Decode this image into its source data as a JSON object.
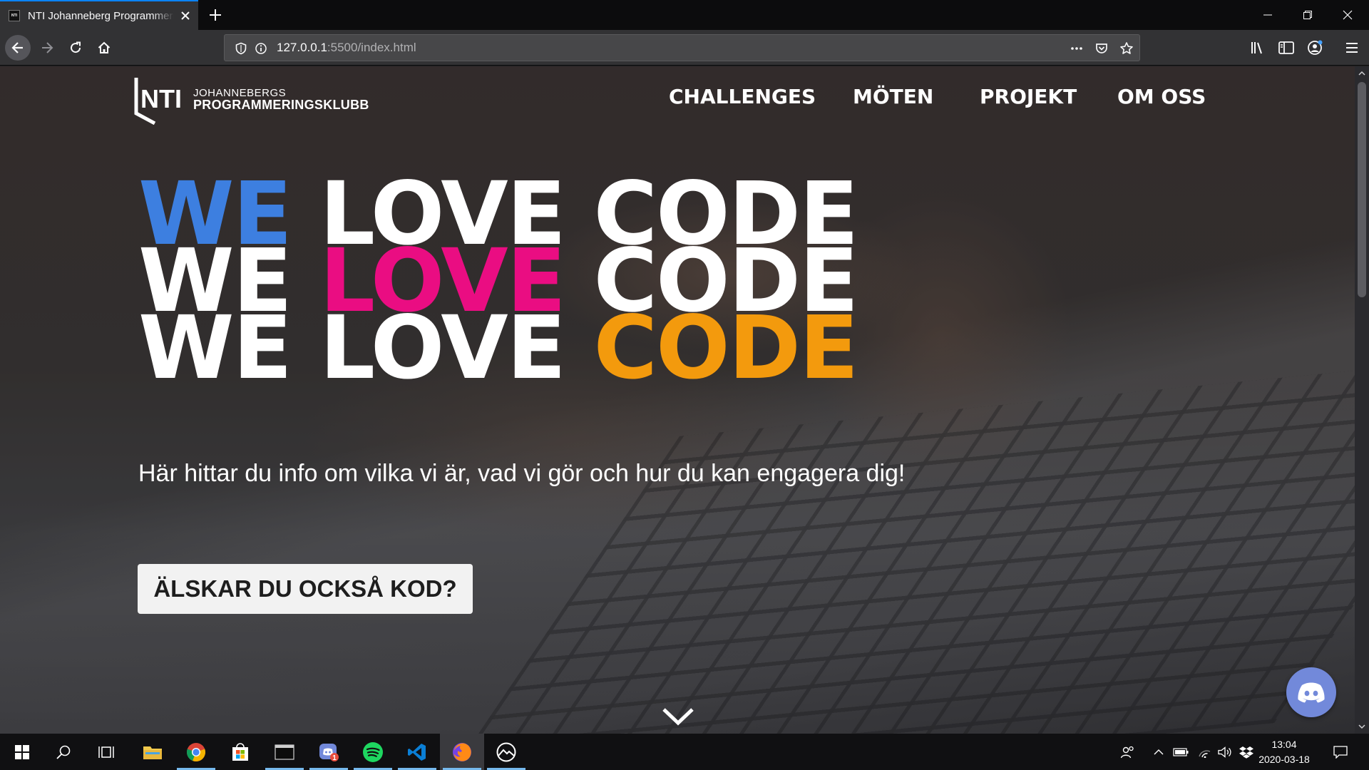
{
  "browser": {
    "tab_title": "NTI Johanneberg Programmeringsklubb",
    "favicon_text": "NTI",
    "url_host": "127.0.0.1",
    "url_path": ":5500/index.html"
  },
  "site": {
    "logo": {
      "mark": "NTI",
      "line1": "JOHANNEBERGS",
      "line2": "PROGRAMMERINGSKLUBB"
    },
    "nav": [
      "CHALLENGES",
      "MÖTEN",
      "PROJEKT",
      "OM OSS"
    ],
    "hero_words": [
      "WE",
      "LOVE",
      "CODE"
    ],
    "hero_colors": {
      "blue": "#3d7fe0",
      "pink": "#ea0d82",
      "orange": "#f39a0d",
      "white": "#ffffff"
    },
    "tagline": "Här hittar du info om vilka vi är, vad vi gör och hur du kan engagera dig!",
    "cta": "ÄLSKAR DU OCKSÅ KOD?"
  },
  "taskbar": {
    "time": "13:04",
    "date": "2020-03-18",
    "discord_badge": "1"
  }
}
